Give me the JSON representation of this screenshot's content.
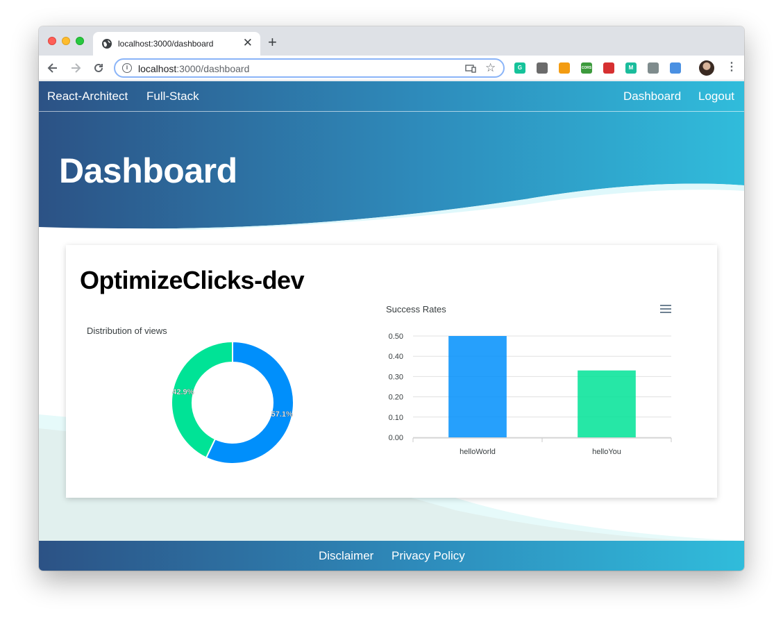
{
  "browser": {
    "tab_title": "localhost:3000/dashboard",
    "tab_close": "✕",
    "new_tab": "+",
    "url_host": "localhost",
    "url_path": ":3000/dashboard",
    "info": "i",
    "star": "☆",
    "menu": "⋮",
    "extensions": [
      {
        "name": "grammarly-extension-icon",
        "label": "G",
        "color": "#15c39a"
      },
      {
        "name": "circle-extension-icon",
        "label": "",
        "color": "#6b6b6b"
      },
      {
        "name": "orange-extension-icon",
        "label": "",
        "color": "#f39c12"
      },
      {
        "name": "cors-extension-icon",
        "label": "CORS",
        "color": "#3c9a3c"
      },
      {
        "name": "bug-extension-icon",
        "label": "",
        "color": "#d63031"
      },
      {
        "name": "m-extension-icon",
        "label": "M",
        "color": "#1abc9c"
      },
      {
        "name": "database-extension-icon",
        "label": "",
        "color": "#7f8c8d"
      },
      {
        "name": "redux-extension-icon",
        "label": "",
        "color": "#4a90e2"
      }
    ]
  },
  "nav": {
    "brand": "React-Architect",
    "fullstack": "Full-Stack",
    "dashboard": "Dashboard",
    "logout": "Logout"
  },
  "hero": {
    "title": "Dashboard"
  },
  "card": {
    "title": "OptimizeClicks-dev"
  },
  "chart_data": [
    {
      "type": "pie",
      "title": "Distribution of views",
      "slices": [
        {
          "label": "57.1%",
          "value": 57.1,
          "color": "#008ffb"
        },
        {
          "label": "42.9%",
          "value": 42.9,
          "color": "#00e396"
        }
      ]
    },
    {
      "type": "bar",
      "title": "Success Rates",
      "categories": [
        "helloWorld",
        "helloYou"
      ],
      "values": [
        0.5,
        0.33
      ],
      "colors": [
        "#008ffb",
        "#00e396"
      ],
      "ylim": [
        0,
        0.5
      ],
      "yticks": [
        "0.00",
        "0.10",
        "0.20",
        "0.30",
        "0.40",
        "0.50"
      ],
      "grid": true
    }
  ],
  "footer": {
    "disclaimer": "Disclaimer",
    "privacy": "Privacy Policy"
  }
}
